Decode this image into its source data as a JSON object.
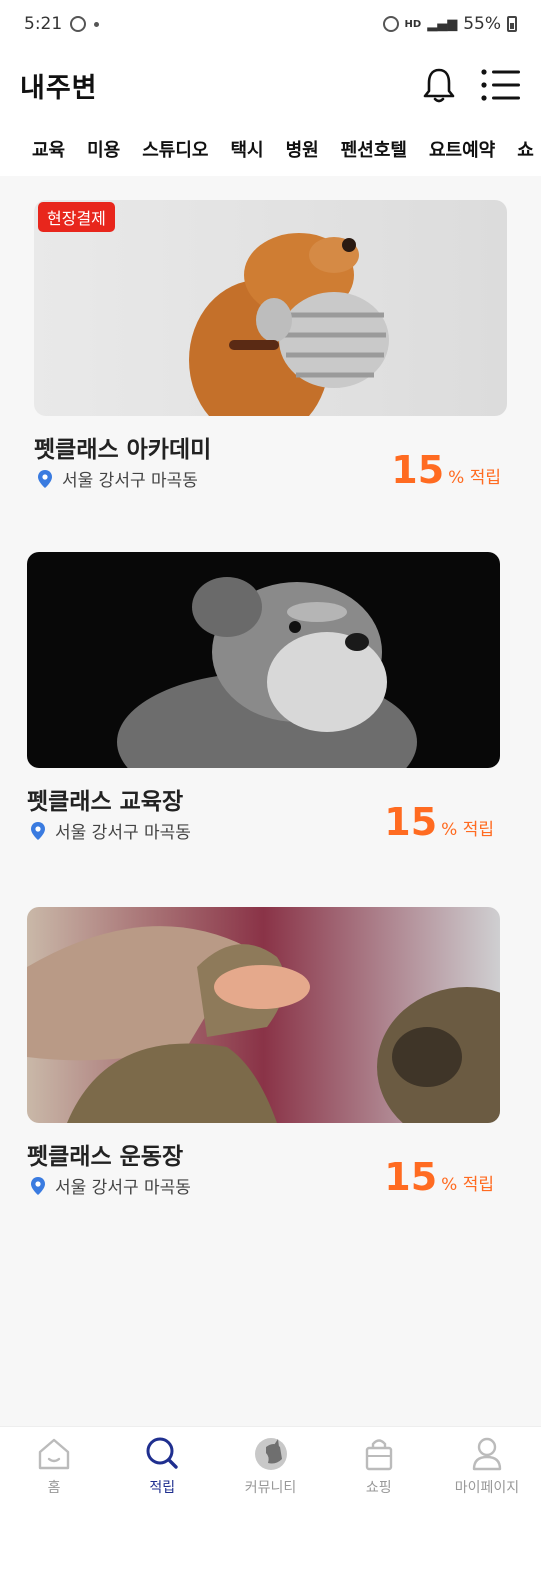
{
  "status_bar": {
    "time": "5:21",
    "battery": "55%",
    "hd_label": "HD"
  },
  "header": {
    "title": "내주변",
    "bell_icon": "bell-icon",
    "menu_icon": "list-menu-icon"
  },
  "category_tabs": [
    "교육",
    "미용",
    "스튜디오",
    "택시",
    "병원",
    "펜션호텔",
    "요트예약",
    "쇼"
  ],
  "cards": [
    {
      "badge": "현장결제",
      "name": "펫클래스 아카데미",
      "location": "서울 강서구 마곡동",
      "reward_value": "15",
      "reward_unit": "% 적립",
      "photo": "dog-with-toy"
    },
    {
      "badge": "",
      "name": "펫클래스 교육장",
      "location": "서울 강서구 마곡동",
      "reward_value": "15",
      "reward_unit": "% 적립",
      "photo": "schnauzer"
    },
    {
      "badge": "",
      "name": "펫클래스 운동장",
      "location": "서울 강서구 마곡동",
      "reward_value": "15",
      "reward_unit": "% 적립",
      "photo": "cat-paw-and-hand"
    }
  ],
  "bottom_nav": [
    {
      "label": "홈",
      "icon": "home-icon",
      "active": false
    },
    {
      "label": "적립",
      "icon": "search-icon",
      "active": true
    },
    {
      "label": "커뮤니티",
      "icon": "community-icon",
      "active": false
    },
    {
      "label": "쇼핑",
      "icon": "shopping-bag-icon",
      "active": false
    },
    {
      "label": "마이페이지",
      "icon": "user-icon",
      "active": false
    }
  ],
  "colors": {
    "accent": "#ff6b21",
    "badge": "#e8261c",
    "nav_active": "#1f2f8f",
    "pin": "#3a7be0"
  }
}
